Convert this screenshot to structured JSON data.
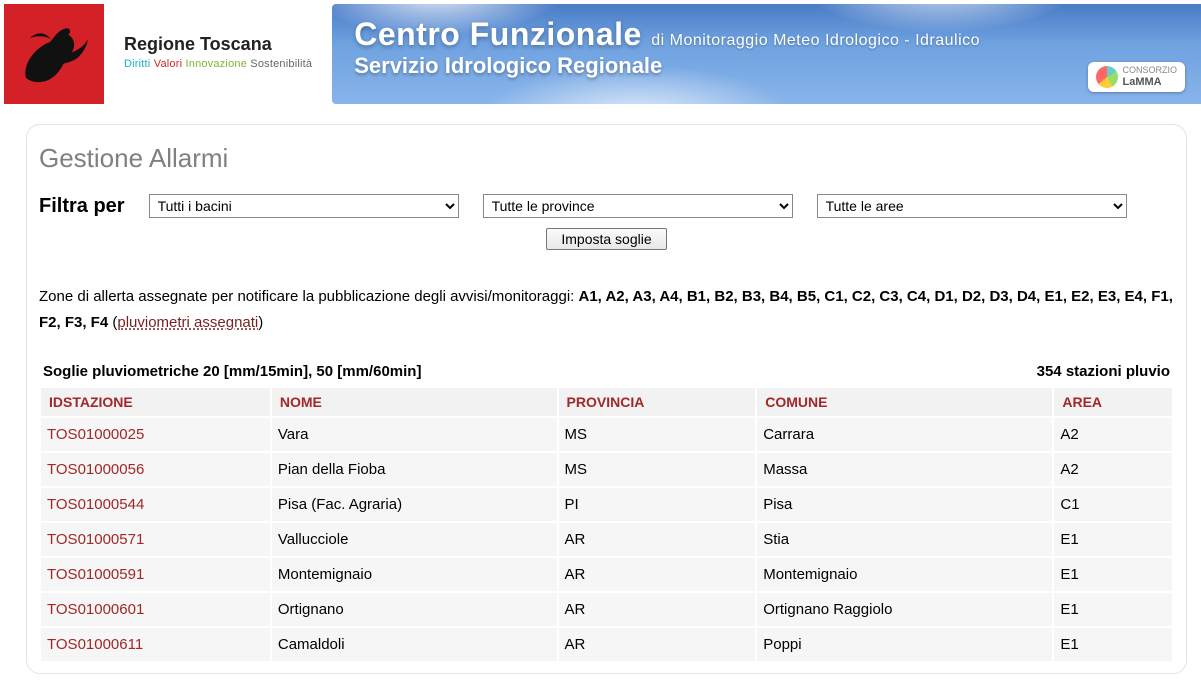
{
  "brand": {
    "title": "Regione Toscana",
    "subtitle_parts": [
      {
        "text": "Diritti",
        "color": "#18b1cc"
      },
      {
        "text": "Valori",
        "color": "#cf2a2a"
      },
      {
        "text": "Innovazione",
        "color": "#7ab92c"
      },
      {
        "text": "Sostenibilità",
        "color": "#666666"
      }
    ]
  },
  "banner": {
    "main": "Centro Funzionale",
    "tail": "di Monitoraggio Meteo Idrologico - Idraulico",
    "line2": "Servizio Idrologico Regionale",
    "lamma_label": "CONSORZIO",
    "lamma_name": "LaMMA"
  },
  "page": {
    "title": "Gestione Allarmi",
    "filter_label": "Filtra per",
    "select_bacini": "Tutti i bacini",
    "select_province": "Tutte le province",
    "select_aree": "Tutte le aree",
    "set_button": "Imposta soglie",
    "zones_intro": "Zone di allerta assegnate per notificare la pubblicazione degli avvisi/monitoraggi: ",
    "zones_list": "A1, A2, A3, A4, B1, B2, B3, B4, B5, C1, C2, C3, C4, D1, D2, D3, D4, E1, E2, E3, E4, F1, F2, F3, F4",
    "pluv_link": "pluviometri assegnati",
    "table_caption": "Soglie pluviometriche 20 [mm/15min], 50 [mm/60min]",
    "station_count_text": "354 stazioni pluvio"
  },
  "table": {
    "headers": {
      "id": "IDSTAZIONE",
      "name": "NOME",
      "prov": "PROVINCIA",
      "comune": "COMUNE",
      "area": "AREA"
    },
    "rows": [
      {
        "id": "TOS01000025",
        "name": "Vara",
        "prov": "MS",
        "comune": "Carrara",
        "area": "A2"
      },
      {
        "id": "TOS01000056",
        "name": "Pian della Fioba",
        "prov": "MS",
        "comune": "Massa",
        "area": "A2"
      },
      {
        "id": "TOS01000544",
        "name": "Pisa (Fac. Agraria)",
        "prov": "PI",
        "comune": "Pisa",
        "area": "C1"
      },
      {
        "id": "TOS01000571",
        "name": "Vallucciole",
        "prov": "AR",
        "comune": "Stia",
        "area": "E1"
      },
      {
        "id": "TOS01000591",
        "name": "Montemignaio",
        "prov": "AR",
        "comune": "Montemignaio",
        "area": "E1"
      },
      {
        "id": "TOS01000601",
        "name": "Ortignano",
        "prov": "AR",
        "comune": "Ortignano Raggiolo",
        "area": "E1"
      },
      {
        "id": "TOS01000611",
        "name": "Camaldoli",
        "prov": "AR",
        "comune": "Poppi",
        "area": "E1"
      }
    ]
  }
}
